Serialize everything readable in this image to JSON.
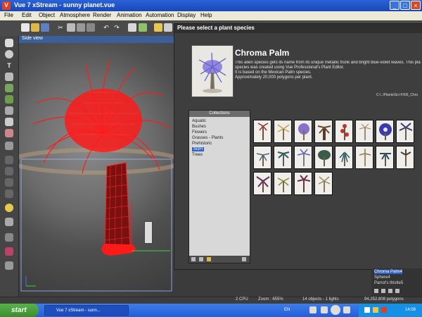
{
  "window": {
    "title": "Vue 7 xStream - sunny planet.vue",
    "app_icon": "V",
    "min_label": "_",
    "max_label": "□",
    "close_label": "×"
  },
  "menu": [
    "File",
    "Edit",
    "Object",
    "Atmosphere",
    "Render",
    "Animation",
    "Automation",
    "Display",
    "Help"
  ],
  "toolbar_icons": [
    "new-file-icon",
    "open-file-icon",
    "save-icon",
    "cut-icon",
    "copy-icon",
    "paste-icon",
    "undo-icon",
    "redo-icon",
    "tool-icon",
    "render-icon",
    "settings-icon",
    "objects-icon",
    "grid-icon"
  ],
  "viewport": {
    "label": "Side view"
  },
  "dialog": {
    "title": "Please select a plant species",
    "plant_name": "Chroma Palm",
    "description": [
      "This alien species gets its name from its unique metallic trunk and bright blue-violet leaves. This pla",
      "species was created using Vue Professional's Plant Editor.",
      "It is based on the Mexican Palm species.",
      "Approximately 20,000 polygons per plant."
    ],
    "path": "C:\\..\\Plants\\Sci-Fi\\06_Chro",
    "collections_title": "Collections",
    "collections": [
      "Aquatic",
      "Bushes",
      "Flowers",
      "Grasses - Plants",
      "Prehistoric",
      "SciFi",
      "Trees"
    ],
    "selected_collection": "SciFi"
  },
  "scene_list": [
    "Chroma Palm4",
    "Sphere4",
    "Parrot's thistle5"
  ],
  "status": {
    "cpu": "2 CPU",
    "zoom": "Zoom : 655%",
    "objects": "14 objects - 1 lights",
    "polygons": "94,252,808 polygons"
  },
  "taskbar": {
    "start": "start",
    "item": "Vue 7 xStream - sunn...",
    "lang": "EN",
    "clock": "14:08"
  },
  "colors": {
    "titlebar": "#2a63d8",
    "selection": "#2f63c9",
    "wireframe": "#ff1a1a"
  }
}
